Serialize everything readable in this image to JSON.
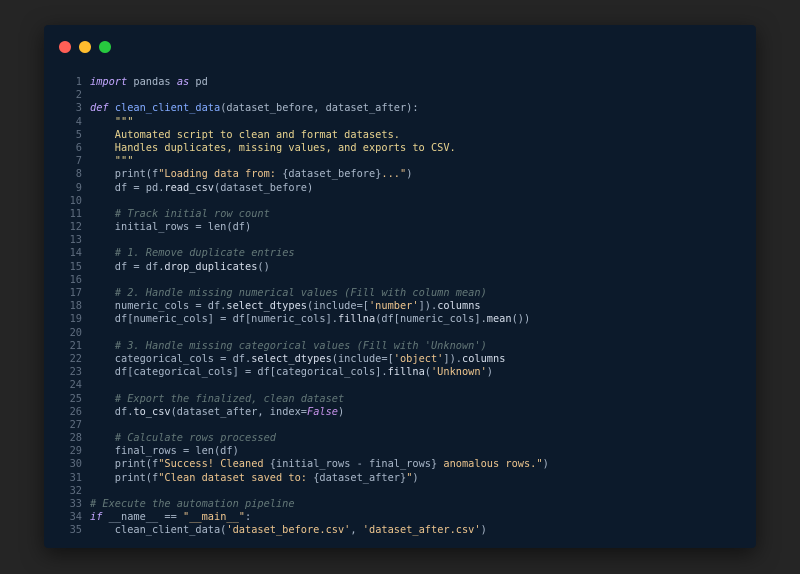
{
  "window": {
    "controls": [
      "close",
      "minimize",
      "maximize"
    ]
  },
  "colors": {
    "background": "#252525",
    "editor": "#0c1a2b",
    "close": "#ff5f56",
    "minimize": "#ffbd2e",
    "maximize": "#27c93f"
  },
  "code": {
    "language": "python",
    "lines": [
      {
        "n": "1",
        "t": [
          [
            "kw",
            "import"
          ],
          [
            "pl",
            " pandas "
          ],
          [
            "kw",
            "as"
          ],
          [
            "pl",
            " pd"
          ]
        ]
      },
      {
        "n": "2",
        "t": []
      },
      {
        "n": "3",
        "t": [
          [
            "kw",
            "def"
          ],
          [
            "pl",
            " "
          ],
          [
            "fn",
            "clean_client_data"
          ],
          [
            "pl",
            "(dataset_before, dataset_after):"
          ]
        ]
      },
      {
        "n": "4",
        "t": [
          [
            "pl",
            "    "
          ],
          [
            "doc",
            "\"\"\""
          ]
        ]
      },
      {
        "n": "5",
        "t": [
          [
            "doc",
            "    Automated script to clean and format datasets."
          ]
        ]
      },
      {
        "n": "6",
        "t": [
          [
            "doc",
            "    Handles duplicates, missing values, and exports to CSV."
          ]
        ]
      },
      {
        "n": "7",
        "t": [
          [
            "doc",
            "    \"\"\""
          ]
        ]
      },
      {
        "n": "8",
        "t": [
          [
            "pl",
            "    print(f"
          ],
          [
            "str",
            "\"Loading data from: "
          ],
          [
            "pl",
            "{dataset_before}"
          ],
          [
            "str",
            "...\""
          ],
          [
            "pl",
            ")"
          ]
        ]
      },
      {
        "n": "9",
        "t": [
          [
            "pl",
            "    df = pd."
          ],
          [
            "mt",
            "read_csv"
          ],
          [
            "pl",
            "(dataset_before)"
          ]
        ]
      },
      {
        "n": "10",
        "t": []
      },
      {
        "n": "11",
        "t": [
          [
            "pl",
            "    "
          ],
          [
            "cm",
            "# Track initial row count"
          ]
        ]
      },
      {
        "n": "12",
        "t": [
          [
            "pl",
            "    initial_rows = len(df)"
          ]
        ]
      },
      {
        "n": "13",
        "t": []
      },
      {
        "n": "14",
        "t": [
          [
            "pl",
            "    "
          ],
          [
            "cm",
            "# 1. Remove duplicate entries"
          ]
        ]
      },
      {
        "n": "15",
        "t": [
          [
            "pl",
            "    df = df."
          ],
          [
            "mt",
            "drop_duplicates"
          ],
          [
            "pl",
            "()"
          ]
        ]
      },
      {
        "n": "16",
        "t": []
      },
      {
        "n": "17",
        "t": [
          [
            "pl",
            "    "
          ],
          [
            "cm",
            "# 2. Handle missing numerical values (Fill with column mean)"
          ]
        ]
      },
      {
        "n": "18",
        "t": [
          [
            "pl",
            "    numeric_cols = df."
          ],
          [
            "mt",
            "select_dtypes"
          ],
          [
            "pl",
            "(include=["
          ],
          [
            "str",
            "'number'"
          ],
          [
            "pl",
            "])."
          ],
          [
            "mt",
            "columns"
          ]
        ]
      },
      {
        "n": "19",
        "t": [
          [
            "pl",
            "    df[numeric_cols] = df[numeric_cols]."
          ],
          [
            "mt",
            "fillna"
          ],
          [
            "pl",
            "(df[numeric_cols]."
          ],
          [
            "mt",
            "mean"
          ],
          [
            "pl",
            "())"
          ]
        ]
      },
      {
        "n": "20",
        "t": []
      },
      {
        "n": "21",
        "t": [
          [
            "pl",
            "    "
          ],
          [
            "cm",
            "# 3. Handle missing categorical values (Fill with 'Unknown')"
          ]
        ]
      },
      {
        "n": "22",
        "t": [
          [
            "pl",
            "    categorical_cols = df."
          ],
          [
            "mt",
            "select_dtypes"
          ],
          [
            "pl",
            "(include=["
          ],
          [
            "str",
            "'object'"
          ],
          [
            "pl",
            "])."
          ],
          [
            "mt",
            "columns"
          ]
        ]
      },
      {
        "n": "23",
        "t": [
          [
            "pl",
            "    df[categorical_cols] = df[categorical_cols]."
          ],
          [
            "mt",
            "fillna"
          ],
          [
            "pl",
            "("
          ],
          [
            "str",
            "'Unknown'"
          ],
          [
            "pl",
            ")"
          ]
        ]
      },
      {
        "n": "24",
        "t": []
      },
      {
        "n": "25",
        "t": [
          [
            "pl",
            "    "
          ],
          [
            "cm",
            "# Export the finalized, clean dataset"
          ]
        ]
      },
      {
        "n": "26",
        "t": [
          [
            "pl",
            "    df."
          ],
          [
            "mt",
            "to_csv"
          ],
          [
            "pl",
            "(dataset_after, index="
          ],
          [
            "bool",
            "False"
          ],
          [
            "pl",
            ")"
          ]
        ]
      },
      {
        "n": "27",
        "t": []
      },
      {
        "n": "28",
        "t": [
          [
            "pl",
            "    "
          ],
          [
            "cm",
            "# Calculate rows processed"
          ]
        ]
      },
      {
        "n": "29",
        "t": [
          [
            "pl",
            "    final_rows = len(df)"
          ]
        ]
      },
      {
        "n": "30",
        "t": [
          [
            "pl",
            "    print(f"
          ],
          [
            "str",
            "\"Success! Cleaned "
          ],
          [
            "pl",
            "{initial_rows - final_rows}"
          ],
          [
            "str",
            " anomalous rows.\""
          ],
          [
            "pl",
            ")"
          ]
        ]
      },
      {
        "n": "31",
        "t": [
          [
            "pl",
            "    print(f"
          ],
          [
            "str",
            "\"Clean dataset saved to: "
          ],
          [
            "pl",
            "{dataset_after}"
          ],
          [
            "str",
            "\""
          ],
          [
            "pl",
            ")"
          ]
        ]
      },
      {
        "n": "32",
        "t": []
      },
      {
        "n": "33",
        "t": [
          [
            "cm",
            "# Execute the automation pipeline"
          ]
        ]
      },
      {
        "n": "34",
        "t": [
          [
            "kw",
            "if"
          ],
          [
            "pl",
            " __name__ == "
          ],
          [
            "str",
            "\"__main__\""
          ],
          [
            "pl",
            ":"
          ]
        ]
      },
      {
        "n": "35",
        "t": [
          [
            "pl",
            "    clean_client_data("
          ],
          [
            "str",
            "'dataset_before.csv'"
          ],
          [
            "pl",
            ", "
          ],
          [
            "str",
            "'dataset_after.csv'"
          ],
          [
            "pl",
            ")"
          ]
        ]
      }
    ]
  }
}
